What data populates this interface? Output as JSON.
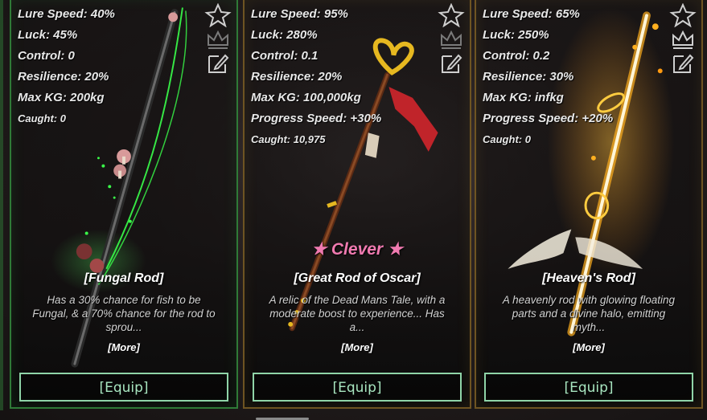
{
  "cards": [
    {
      "stats": [
        {
          "label": "Lure Speed: 40%"
        },
        {
          "label": "Luck: 45%"
        },
        {
          "label": "Control: 0"
        },
        {
          "label": "Resilience: 20%"
        },
        {
          "label": "Max KG: 200kg"
        }
      ],
      "caught": "Caught: 0",
      "badge": "",
      "name": "[Fungal Rod]",
      "description": "Has a 30% chance for fish to be Fungal, & a 70% chance for the rod to sprou...",
      "more": "[More]",
      "equip": "[Equip]",
      "accent": "#2f7a37"
    },
    {
      "stats": [
        {
          "label": "Lure Speed: 95%"
        },
        {
          "label": "Luck: 280%"
        },
        {
          "label": "Control: 0.1"
        },
        {
          "label": "Resilience: 20%"
        },
        {
          "label": "Max KG: 100,000kg"
        },
        {
          "label": "Progress Speed: +30%"
        }
      ],
      "caught": "Caught: 10,975",
      "badge": "★ Clever ★",
      "name": "[Great Rod of Oscar]",
      "description": "A relic of the Dead Mans Tale, with a moderate boost to experience... Has a...",
      "more": "[More]",
      "equip": "[Equip]",
      "accent": "#6e5422"
    },
    {
      "stats": [
        {
          "label": "Lure Speed: 65%"
        },
        {
          "label": "Luck: 250%"
        },
        {
          "label": "Control: 0.2"
        },
        {
          "label": "Resilience: 30%"
        },
        {
          "label": "Max KG: infkg"
        },
        {
          "label": "Progress Speed: +20%"
        }
      ],
      "caught": "Caught: 0",
      "badge": "",
      "name": "[Heaven's Rod]",
      "description": "A heavenly rod with glowing floating parts and a divine halo, emitting myth...",
      "more": "[More]",
      "equip": "[Equip]",
      "accent": "#6e5422"
    }
  ],
  "icons": [
    "star-icon",
    "crown-icon",
    "edit-icon"
  ],
  "colors": {
    "equip_border": "#8fd4a8",
    "equip_text": "#a8e6c0",
    "badge": "#f07ab0",
    "green_frame": "#2f7a37",
    "gold_frame": "#6e5422"
  }
}
